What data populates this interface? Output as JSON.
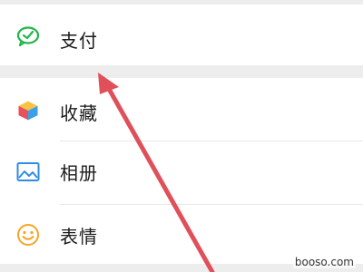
{
  "menu": {
    "pay": {
      "label": "支付",
      "icon": "pay-icon"
    },
    "items": [
      {
        "label": "收藏",
        "icon": "favorites-icon"
      },
      {
        "label": "相册",
        "icon": "album-icon"
      },
      {
        "label": "表情",
        "icon": "stickers-icon"
      }
    ]
  },
  "watermark": "booso.com",
  "colors": {
    "background": "#ededed",
    "row": "#ffffff",
    "pay_green": "#23b54a",
    "arrow_red": "#e0505a",
    "album_blue": "#2f8de4",
    "sticker_orange": "#f5a623"
  }
}
